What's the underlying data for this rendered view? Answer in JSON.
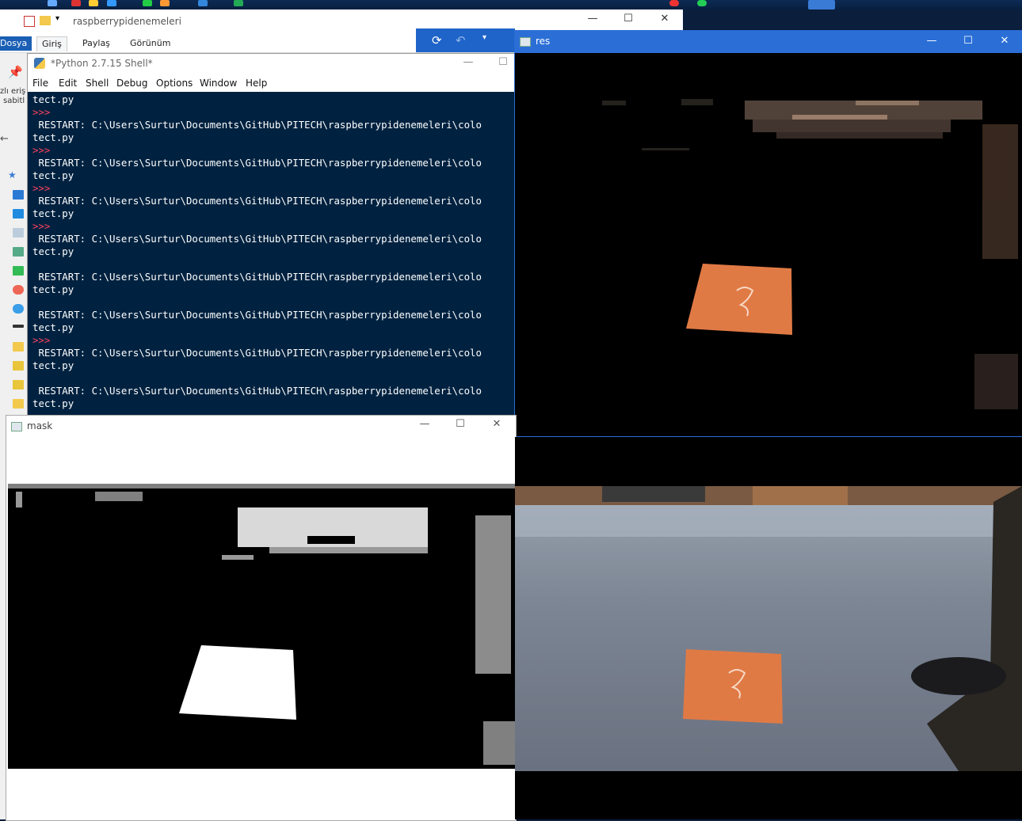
{
  "explorer": {
    "title": "raspberrypidenemeleri",
    "ribbon_tabs": [
      "Dosya",
      "Giriş",
      "Paylaş",
      "Görünüm"
    ],
    "sidebar_partial": [
      "zlı eriş",
      "sabitl"
    ],
    "controls": {
      "minimize": "—",
      "maximize": "☐",
      "close": "✕"
    }
  },
  "shell": {
    "title": "*Python 2.7.15 Shell*",
    "menu": [
      "File",
      "Edit",
      "Shell",
      "Debug",
      "Options",
      "Window",
      "Help"
    ],
    "controls": {
      "minimize": "—",
      "maximize": "☐"
    },
    "lines": [
      {
        "text": "tect.py",
        "prompt": false
      },
      {
        "text": ">>>",
        "prompt": true
      },
      {
        "text": " RESTART: C:\\Users\\Surtur\\Documents\\GitHub\\PITECH\\raspberrypidenemeleri\\colo",
        "prompt": false
      },
      {
        "text": "tect.py",
        "prompt": false
      },
      {
        "text": ">>>",
        "prompt": true
      },
      {
        "text": " RESTART: C:\\Users\\Surtur\\Documents\\GitHub\\PITECH\\raspberrypidenemeleri\\colo",
        "prompt": false
      },
      {
        "text": "tect.py",
        "prompt": false
      },
      {
        "text": ">>>",
        "prompt": true
      },
      {
        "text": " RESTART: C:\\Users\\Surtur\\Documents\\GitHub\\PITECH\\raspberrypidenemeleri\\colo",
        "prompt": false
      },
      {
        "text": "tect.py",
        "prompt": false
      },
      {
        "text": ">>>",
        "prompt": true
      },
      {
        "text": " RESTART: C:\\Users\\Surtur\\Documents\\GitHub\\PITECH\\raspberrypidenemeleri\\colo",
        "prompt": false
      },
      {
        "text": "tect.py",
        "prompt": false
      },
      {
        "text": "",
        "prompt": false
      },
      {
        "text": " RESTART: C:\\Users\\Surtur\\Documents\\GitHub\\PITECH\\raspberrypidenemeleri\\colo",
        "prompt": false
      },
      {
        "text": "tect.py",
        "prompt": false
      },
      {
        "text": "",
        "prompt": false
      },
      {
        "text": " RESTART: C:\\Users\\Surtur\\Documents\\GitHub\\PITECH\\raspberrypidenemeleri\\colo",
        "prompt": false
      },
      {
        "text": "tect.py",
        "prompt": false
      },
      {
        "text": ">>>",
        "prompt": true
      },
      {
        "text": " RESTART: C:\\Users\\Surtur\\Documents\\GitHub\\PITECH\\raspberrypidenemeleri\\colo",
        "prompt": false
      },
      {
        "text": "tect.py",
        "prompt": false
      },
      {
        "text": "",
        "prompt": false
      },
      {
        "text": " RESTART: C:\\Users\\Surtur\\Documents\\GitHub\\PITECH\\raspberrypidenemeleri\\colo",
        "prompt": false
      },
      {
        "text": "tect.py",
        "prompt": false
      }
    ]
  },
  "res_window": {
    "title": "res",
    "controls": {
      "minimize": "—",
      "maximize": "☐",
      "close": "✕"
    }
  },
  "mask_window": {
    "title": "mask",
    "controls": {
      "minimize": "—",
      "maximize": "☐",
      "close": "✕"
    }
  },
  "colors": {
    "shell_bg": "#002240",
    "prompt": "#ff4060",
    "active_titlebar": "#2b6fd6",
    "book_orange": "#e07a45"
  }
}
